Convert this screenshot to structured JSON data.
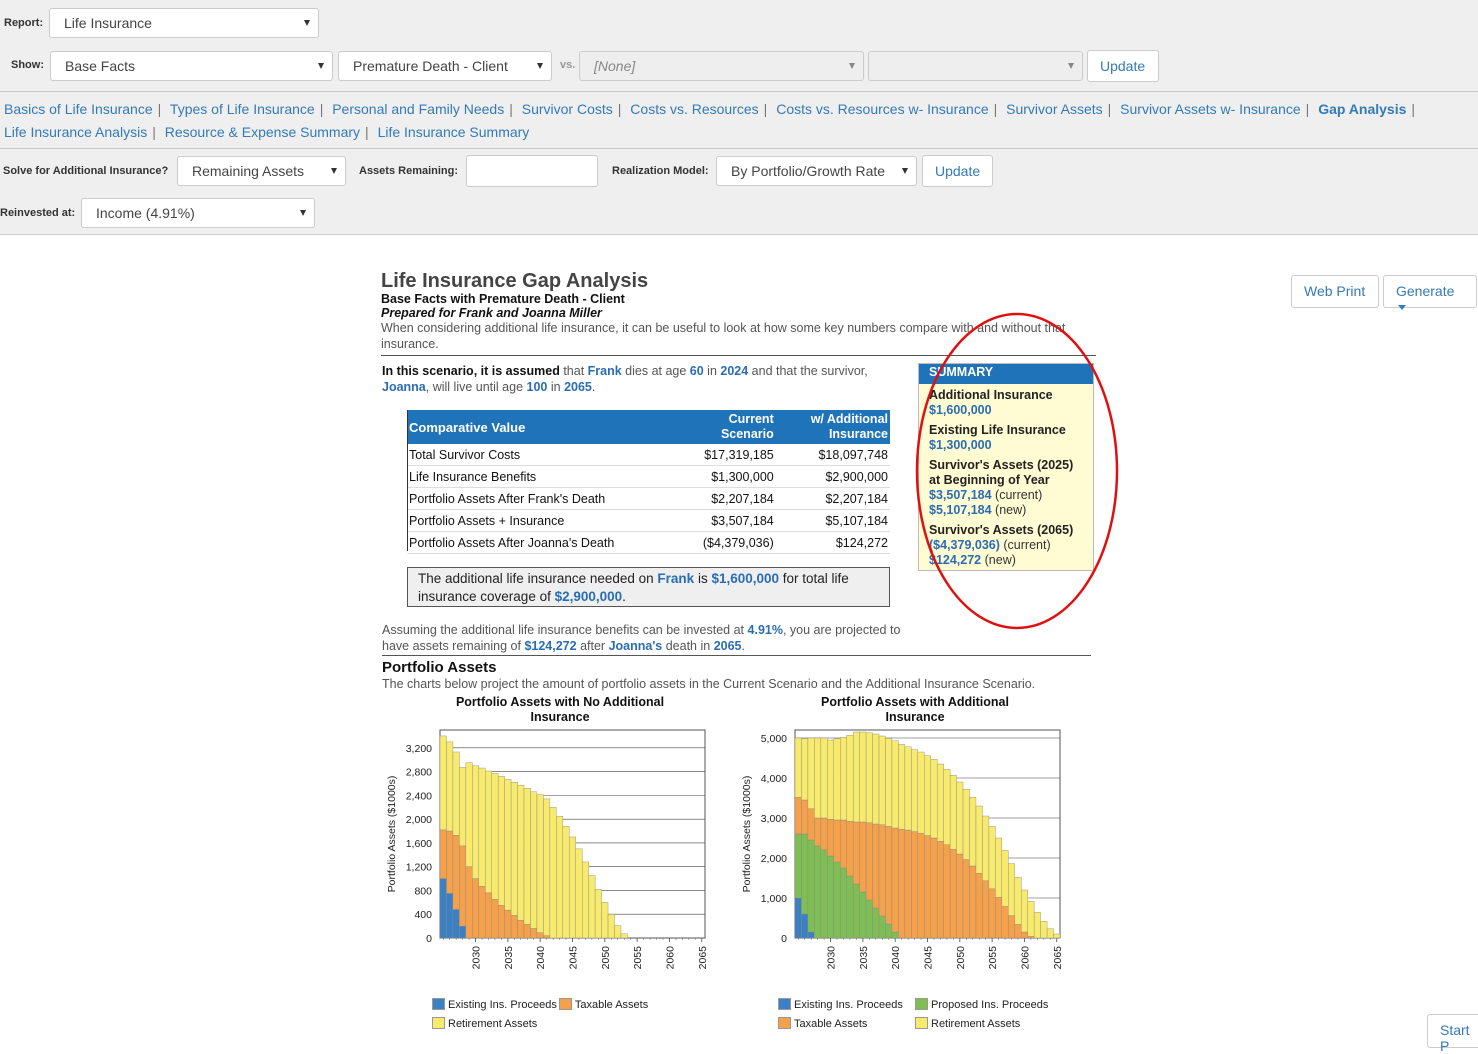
{
  "toolbar": {
    "report_label": "Report:",
    "report_value": "Life Insurance",
    "show_label": "Show:",
    "show_value": "Base Facts",
    "scenario_value": "Premature Death - Client",
    "vs_label": "vs.",
    "vs_value": "[None]",
    "vs2_value": "",
    "update_label": "Update"
  },
  "nav": [
    {
      "label": "Basics of Life Insurance"
    },
    {
      "label": "Types of Life Insurance"
    },
    {
      "label": "Personal and Family Needs"
    },
    {
      "label": "Survivor Costs"
    },
    {
      "label": "Costs vs. Resources"
    },
    {
      "label": "Costs vs. Resources w- Insurance"
    },
    {
      "label": "Survivor Assets"
    },
    {
      "label": "Survivor Assets w- Insurance"
    },
    {
      "label": "Gap Analysis",
      "active": true
    },
    {
      "label": "Life Insurance Analysis"
    },
    {
      "label": "Resource & Expense Summary"
    },
    {
      "label": "Life Insurance Summary"
    }
  ],
  "options": {
    "solve_label": "Solve for Additional Insurance?",
    "solve_value": "Remaining Assets",
    "assets_remaining_label": "Assets Remaining:",
    "assets_remaining_value": "",
    "realization_label": "Realization Model:",
    "realization_value": "By Portfolio/Growth Rate",
    "update_label": "Update",
    "reinvested_label": "Reinvested at:",
    "reinvested_value": "Income (4.91%)"
  },
  "actions": {
    "web_print": "Web Print",
    "generate": "Generate",
    "start": "Start P"
  },
  "report": {
    "title": "Life Insurance Gap Analysis",
    "subtitle": "Base Facts with Premature Death - Client",
    "prepared": "Prepared for Frank and Joanna Miller",
    "intro": "When considering additional life insurance, it can be useful to look at how some key numbers compare with and without that insurance.",
    "scenario": {
      "lead": "In this scenario, it is assumed",
      "t1": " that ",
      "client": "Frank",
      "t2": " dies at age ",
      "age": "60",
      "t3": " in ",
      "year": "2024",
      "t4": " and that the survivor, ",
      "survivor": "Joanna",
      "t5": ", will live until age ",
      "age2": "100",
      "t6": " in ",
      "year2": "2065",
      "t7": "."
    },
    "table": {
      "headers": [
        "Comparative Value",
        "Current Scenario",
        "w/ Additional Insurance"
      ],
      "rows": [
        [
          "Total Survivor Costs",
          "$17,319,185",
          "$18,097,748"
        ],
        [
          "Life Insurance Benefits",
          "$1,300,000",
          "$2,900,000"
        ],
        [
          "Portfolio Assets After Frank's Death",
          "$2,207,184",
          "$2,207,184"
        ],
        [
          "Portfolio Assets + Insurance",
          "$3,507,184",
          "$5,107,184"
        ],
        [
          "Portfolio Assets After Joanna's Death",
          "($4,379,036)",
          "$124,272"
        ]
      ]
    },
    "needed": {
      "t1": "The additional life insurance needed on ",
      "name": "Frank",
      "t2": " is ",
      "amount": "$1,600,000",
      "t3": " for total life insurance coverage of ",
      "total": "$2,900,000",
      "t4": "."
    },
    "assuming": {
      "t1": "Assuming the additional life insurance benefits can be invested at ",
      "rate": "4.91%",
      "t2": ", you are projected to have assets remaining of ",
      "remain": "$124,272",
      "t3": " after ",
      "name": "Joanna's",
      "t4": " death in ",
      "year": "2065",
      "t5": "."
    },
    "portfolio_heading": "Portfolio Assets",
    "portfolio_desc": "The charts below project the amount of portfolio assets in the Current Scenario and the Additional Insurance Scenario."
  },
  "summary": {
    "header": "SUMMARY",
    "add_label": "Additional Insurance",
    "add_value": "$1,600,000",
    "exist_label": "Existing Life Insurance",
    "exist_value": "$1,300,000",
    "sa_label": "Survivor's Assets (2025) at Beginning of Year",
    "sa_cur": "$3,507,184",
    "sa_cur_tag": "(current)",
    "sa_new": "$5,107,184",
    "sa_new_tag": "(new)",
    "se_label": "Survivor's Assets (2065)",
    "se_cur": "($4,379,036)",
    "se_cur_tag": "(current)",
    "se_new": "$124,272",
    "se_new_tag": "(new)"
  },
  "colors": {
    "existing": "#3a80c3",
    "proposed": "#7fbe55",
    "taxable": "#f5a04a",
    "retirement": "#f7ea6c",
    "accent": "#1f73b8",
    "circle": "#e01010"
  },
  "chart_data": [
    {
      "type": "bar",
      "stacked": true,
      "title": "Portfolio Assets with No Additional Insurance",
      "ylabel": "Portfolio Assets ($1000s)",
      "ylim": [
        0,
        3500
      ],
      "yticks": [
        0,
        400,
        800,
        1200,
        1600,
        2000,
        2400,
        2800,
        3200
      ],
      "xticks": [
        2030,
        2035,
        2040,
        2045,
        2050,
        2055,
        2060,
        2065
      ],
      "x": [
        2025,
        2026,
        2027,
        2028,
        2029,
        2030,
        2031,
        2032,
        2033,
        2034,
        2035,
        2036,
        2037,
        2038,
        2039,
        2040,
        2041,
        2042,
        2043,
        2044,
        2045,
        2046,
        2047,
        2048,
        2049,
        2050,
        2051,
        2052,
        2053,
        2054,
        2055,
        2056,
        2057,
        2058,
        2059,
        2060,
        2061,
        2062,
        2063,
        2064,
        2065
      ],
      "series": [
        {
          "name": "Existing Ins. Proceeds",
          "color": "#3a80c3",
          "values": [
            1000,
            750,
            480,
            200,
            0,
            0,
            0,
            0,
            0,
            0,
            0,
            0,
            0,
            0,
            0,
            0,
            0,
            0,
            0,
            0,
            0,
            0,
            0,
            0,
            0,
            0,
            0,
            0,
            0,
            0,
            0,
            0,
            0,
            0,
            0,
            0,
            0,
            0,
            0,
            0,
            0
          ]
        },
        {
          "name": "Taxable Assets",
          "color": "#f5a04a",
          "values": [
            820,
            1050,
            1250,
            1350,
            1200,
            1000,
            870,
            760,
            650,
            550,
            470,
            380,
            300,
            230,
            160,
            90,
            40,
            0,
            0,
            0,
            0,
            0,
            0,
            0,
            0,
            0,
            0,
            0,
            0,
            0,
            0,
            0,
            0,
            0,
            0,
            0,
            0,
            0,
            0,
            0,
            0
          ]
        },
        {
          "name": "Retirement Assets",
          "color": "#f7ea6c",
          "values": [
            1580,
            1500,
            1400,
            1320,
            1750,
            1900,
            1990,
            2050,
            2120,
            2170,
            2200,
            2240,
            2270,
            2290,
            2300,
            2320,
            2300,
            2200,
            2050,
            1880,
            1700,
            1500,
            1280,
            1050,
            820,
            600,
            400,
            210,
            70,
            0,
            0,
            0,
            0,
            0,
            0,
            0,
            0,
            0,
            0,
            0,
            0
          ]
        }
      ]
    },
    {
      "type": "bar",
      "stacked": true,
      "title": "Portfolio Assets with Additional Insurance",
      "ylabel": "Portfolio Assets ($1000s)",
      "ylim": [
        0,
        5200
      ],
      "yticks": [
        0,
        1000,
        2000,
        3000,
        4000,
        5000
      ],
      "xticks": [
        2030,
        2035,
        2040,
        2045,
        2050,
        2055,
        2060,
        2065
      ],
      "x": [
        2025,
        2026,
        2027,
        2028,
        2029,
        2030,
        2031,
        2032,
        2033,
        2034,
        2035,
        2036,
        2037,
        2038,
        2039,
        2040,
        2041,
        2042,
        2043,
        2044,
        2045,
        2046,
        2047,
        2048,
        2049,
        2050,
        2051,
        2052,
        2053,
        2054,
        2055,
        2056,
        2057,
        2058,
        2059,
        2060,
        2061,
        2062,
        2063,
        2064,
        2065
      ],
      "series": [
        {
          "name": "Existing Ins. Proceeds",
          "color": "#3a80c3",
          "values": [
            1000,
            600,
            150,
            0,
            0,
            0,
            0,
            0,
            0,
            0,
            0,
            0,
            0,
            0,
            0,
            0,
            0,
            0,
            0,
            0,
            0,
            0,
            0,
            0,
            0,
            0,
            0,
            0,
            0,
            0,
            0,
            0,
            0,
            0,
            0,
            0,
            0,
            0,
            0,
            0,
            0
          ]
        },
        {
          "name": "Proposed Ins. Proceeds",
          "color": "#7fbe55",
          "values": [
            1600,
            2000,
            2300,
            2300,
            2200,
            2050,
            1900,
            1750,
            1550,
            1350,
            1150,
            950,
            750,
            550,
            350,
            150,
            0,
            0,
            0,
            0,
            0,
            0,
            0,
            0,
            0,
            0,
            0,
            0,
            0,
            0,
            0,
            0,
            0,
            0,
            0,
            0,
            0,
            0,
            0,
            0,
            0
          ]
        },
        {
          "name": "Taxable Assets",
          "color": "#f5a04a",
          "values": [
            920,
            850,
            780,
            700,
            800,
            920,
            1050,
            1200,
            1370,
            1550,
            1750,
            1930,
            2100,
            2280,
            2440,
            2600,
            2720,
            2700,
            2660,
            2620,
            2560,
            2500,
            2420,
            2330,
            2220,
            2100,
            1960,
            1800,
            1620,
            1430,
            1230,
            1020,
            790,
            560,
            340,
            150,
            40,
            0,
            0,
            0,
            0
          ]
        },
        {
          "name": "Retirement Assets",
          "color": "#f7ea6c",
          "values": [
            1480,
            1530,
            1770,
            2000,
            2000,
            1980,
            2030,
            2070,
            2150,
            2250,
            2250,
            2250,
            2250,
            2220,
            2200,
            2180,
            2120,
            2080,
            2050,
            2030,
            2000,
            1970,
            1930,
            1890,
            1850,
            1800,
            1760,
            1720,
            1680,
            1620,
            1560,
            1480,
            1400,
            1300,
            1180,
            1050,
            880,
            640,
            420,
            230,
            100
          ]
        }
      ]
    }
  ]
}
